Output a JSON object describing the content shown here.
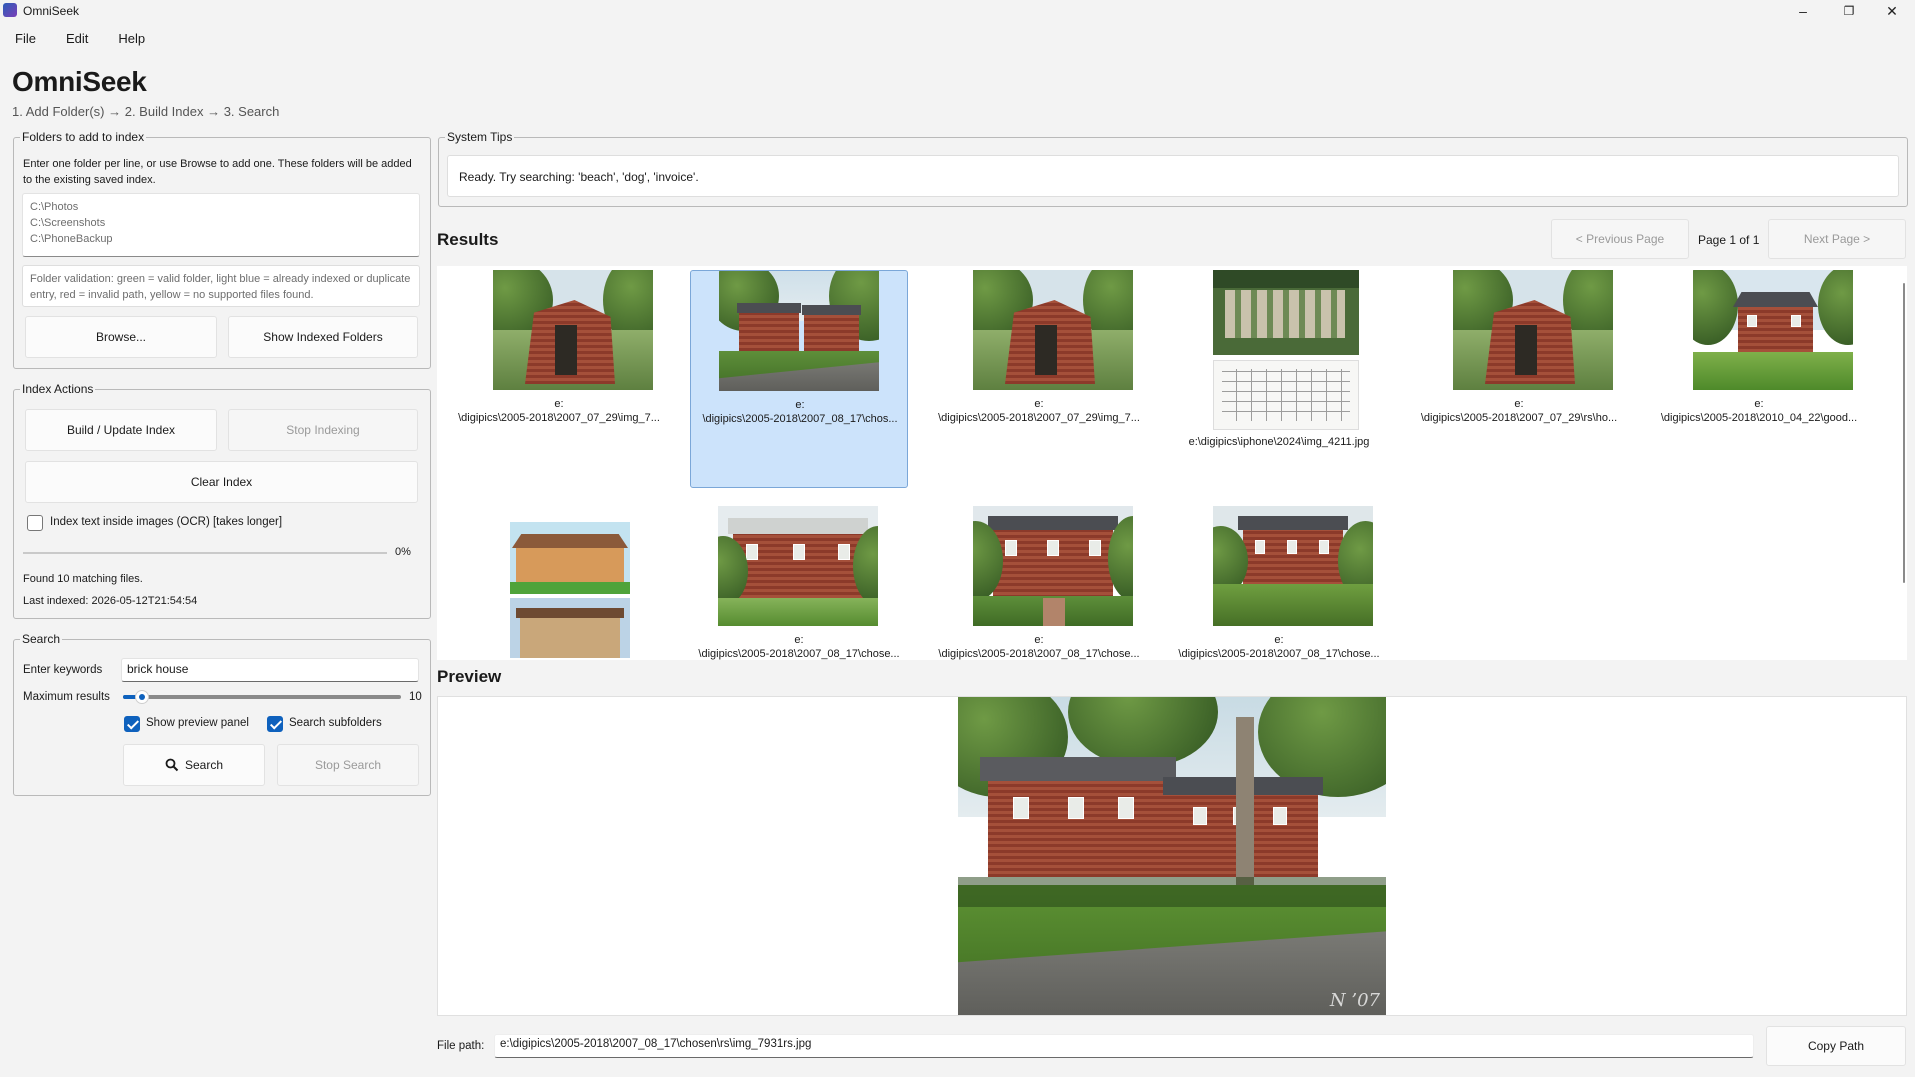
{
  "window": {
    "title": "OmniSeek",
    "minimize": "–",
    "restore": "❐",
    "close": "✕"
  },
  "menu": [
    "File",
    "Edit",
    "Help"
  ],
  "app_title": "OmniSeek",
  "steps": "1. Add Folder(s)  →  2. Build Index  →  3. Search",
  "folders": {
    "legend": "Folders to add to index",
    "instructions": "Enter one folder per line, or use Browse to add one. These folders will be added to the existing saved index.",
    "lines": [
      "C:\\Photos",
      "C:\\Screenshots",
      "C:\\PhoneBackup"
    ],
    "validation": "Folder validation: green = valid folder, light blue = already indexed or duplicate entry, red = invalid path, yellow = no supported files found.",
    "browse": "Browse...",
    "show_indexed": "Show Indexed Folders"
  },
  "index_actions": {
    "legend": "Index Actions",
    "build": "Build / Update Index",
    "stop": "Stop Indexing",
    "clear": "Clear Index",
    "ocr_label": "Index text inside images (OCR) [takes longer]",
    "ocr_checked": false,
    "progress_percent": "0%",
    "progress_fraction": 0,
    "found": "Found 10 matching files.",
    "last_indexed": "Last indexed: 2026-05-12T21:54:54"
  },
  "search": {
    "legend": "Search",
    "keywords_label": "Enter keywords",
    "keywords_value": "brick house",
    "max_label": "Maximum results",
    "max_value": "10",
    "max_fraction": 0.07,
    "show_preview": "Show preview panel",
    "show_preview_checked": true,
    "subfolders": "Search subfolders",
    "subfolders_checked": true,
    "search_btn": "Search",
    "stop_btn": "Stop Search"
  },
  "tips": {
    "legend": "System Tips",
    "text": "Ready. Try searching: 'beach', 'dog', 'invoice'."
  },
  "results": {
    "title": "Results",
    "prev": "< Previous Page",
    "page": "Page 1 of 1",
    "next": "Next Page >",
    "items": [
      {
        "line1": "e:",
        "line2": "\\digipics\\2005-2018\\2007_07_29\\img_7..."
      },
      {
        "line1": "e:",
        "line2": "\\digipics\\2005-2018\\2007_08_17\\chos..."
      },
      {
        "line1": "e:",
        "line2": "\\digipics\\2005-2018\\2007_07_29\\img_7..."
      },
      {
        "line1": "",
        "line2": "e:\\digipics\\iphone\\2024\\img_4211.jpg"
      },
      {
        "line1": "e:",
        "line2": "\\digipics\\2005-2018\\2007_07_29\\rs\\ho..."
      },
      {
        "line1": "e:",
        "line2": "\\digipics\\2005-2018\\2010_04_22\\good..."
      },
      {
        "line1": "",
        "line2": ""
      },
      {
        "line1": "e:",
        "line2": "\\digipics\\2005-2018\\2007_08_17\\chose..."
      },
      {
        "line1": "e:",
        "line2": "\\digipics\\2005-2018\\2007_08_17\\chose..."
      },
      {
        "line1": "e:",
        "line2": "\\digipics\\2005-2018\\2007_08_17\\chose..."
      }
    ]
  },
  "preview": {
    "title": "Preview",
    "watermark": "N ’07"
  },
  "filepath": {
    "label": "File path:",
    "value": "e:\\digipics\\2005-2018\\2007_08_17\\chosen\\rs\\img_7931rs.jpg",
    "copy": "Copy Path"
  }
}
